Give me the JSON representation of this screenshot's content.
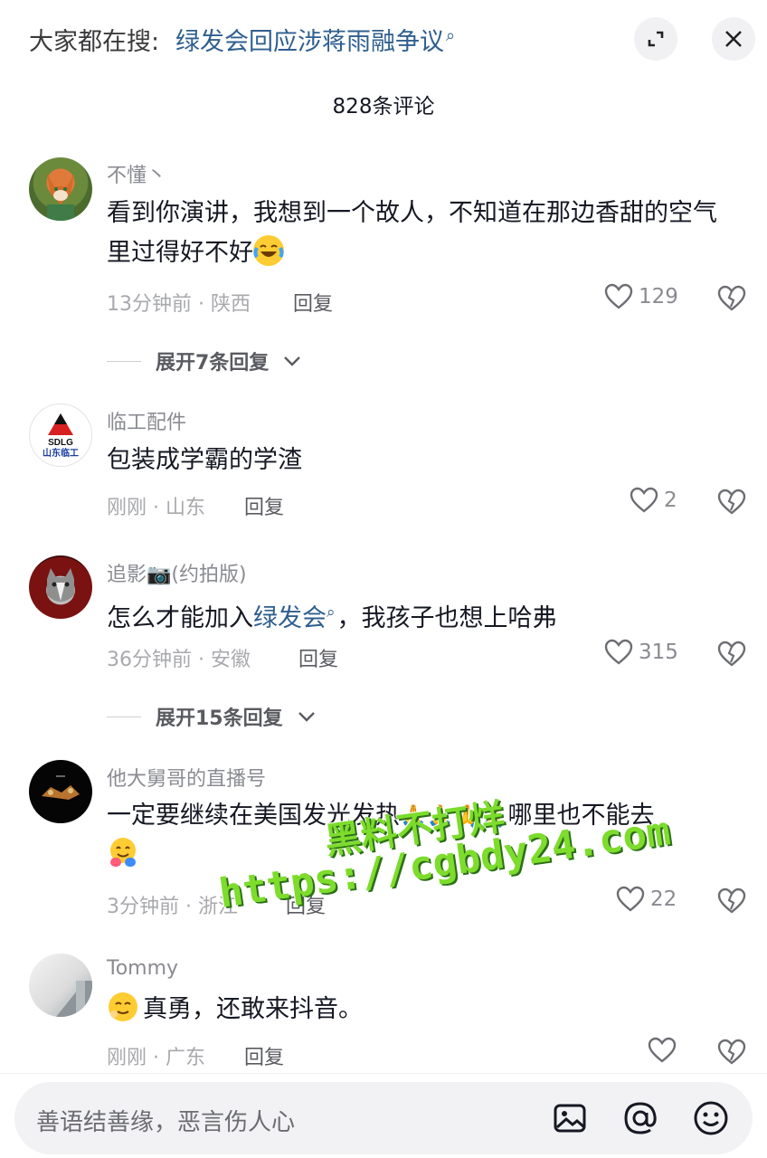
{
  "header": {
    "search_prefix": "大家都在搜:",
    "search_term": "绿发会回应涉蒋雨融争议",
    "comment_count_title": "828条评论"
  },
  "comments": [
    {
      "username": "不懂丶",
      "text": "看到你演讲，我想到一个故人，不知道在那边香甜的空气里过得好不好",
      "emoji": "laughing-crying-emoji",
      "meta": "13分钟前 · 陕西",
      "reply": "回复",
      "likes": "129",
      "expand": "展开7条回复"
    },
    {
      "username": "临工配件",
      "avatar_logo_top": "SDLG",
      "avatar_logo_bottom": "山东临工",
      "text": "包装成学霸的学渣",
      "meta": "刚刚 · 山东",
      "reply": "回复",
      "likes": "2"
    },
    {
      "username": "追影📷(约拍版)",
      "text_before": "怎么才能加入",
      "text_link": "绿发会",
      "text_after": "，我孩子也想上哈弗",
      "meta": "36分钟前 · 安徽",
      "reply": "回复",
      "likes": "315",
      "expand": "展开15条回复"
    },
    {
      "username": "他大舅哥的直播号",
      "text_before": "一定要继续在美国发光发热",
      "text_emojis": "🙏🙏🙏🙏",
      "text_after": "哪里也不能去",
      "meta": "3分钟前 · 浙江",
      "reply": "回复",
      "likes": "22"
    },
    {
      "username": "Tommy",
      "text": "真勇，还敢来抖音。",
      "meta": "刚刚 · 广东",
      "reply": "回复",
      "likes": ""
    }
  ],
  "watermark": {
    "line1": "黑料不打烊",
    "line2": "https://cgbdy24.com"
  },
  "input": {
    "placeholder": "善语结善缘，恶言伤人心"
  },
  "icons": {
    "expand": "expand-icon",
    "close": "close-icon",
    "like": "heart-icon",
    "dislike": "broken-heart-icon",
    "image": "image-icon",
    "mention": "at-icon",
    "emoji": "smiley-icon"
  },
  "colors": {
    "link": "#2f5f8f",
    "watermark": "#7ddc2c"
  }
}
